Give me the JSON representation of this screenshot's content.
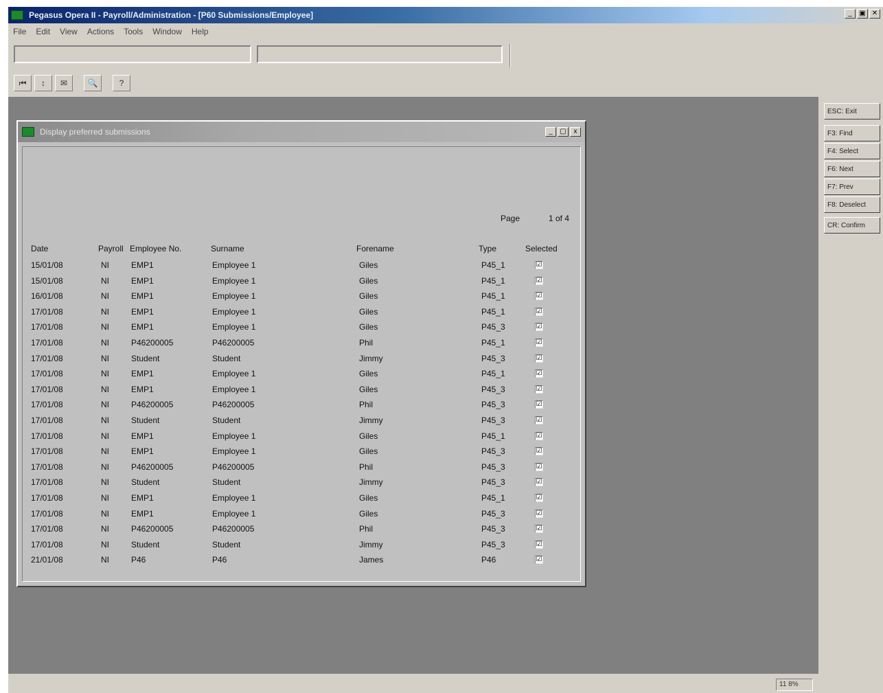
{
  "app": {
    "title": "Pegasus Opera II - Payroll/Administration - [P60 Submissions/Employee]"
  },
  "window_controls": [
    "_",
    "▣",
    "✕"
  ],
  "menu": [
    "File",
    "Edit",
    "View",
    "Actions",
    "Tools",
    "Window",
    "Help"
  ],
  "toolbar": [
    "⏮",
    "↕",
    "✉",
    "🔍",
    "?"
  ],
  "function_keys": [
    "ESC: Exit",
    "F3: Find",
    "F4: Select",
    "F6: Next",
    "F7: Prev",
    "F8: Deselect",
    "CR: Confirm"
  ],
  "status": {
    "zoom": "11 8%"
  },
  "child": {
    "title": "Display preferred submissions",
    "controls": [
      "_",
      "▢",
      "x"
    ],
    "page_label": "Page",
    "page_value": "1 of 4",
    "headers": [
      "Date",
      "Payroll",
      "Employee No.",
      "Surname",
      "Forename",
      "Type",
      "Selected"
    ],
    "rows": [
      [
        "15/01/08",
        "NI",
        "EMP1",
        "Employee 1",
        "Giles",
        "P45_1",
        "☑"
      ],
      [
        "15/01/08",
        "NI",
        "EMP1",
        "Employee 1",
        "Giles",
        "P45_1",
        "☑"
      ],
      [
        "16/01/08",
        "NI",
        "EMP1",
        "Employee 1",
        "Giles",
        "P45_1",
        "☑"
      ],
      [
        "17/01/08",
        "NI",
        "EMP1",
        "Employee 1",
        "Giles",
        "P45_1",
        "☑"
      ],
      [
        "17/01/08",
        "NI",
        "EMP1",
        "Employee 1",
        "Giles",
        "P45_3",
        "☑"
      ],
      [
        "17/01/08",
        "NI",
        "P46200005",
        "P46200005",
        "Phil",
        "P45_1",
        "☑"
      ],
      [
        "17/01/08",
        "NI",
        "Student",
        "Student",
        "Jimmy",
        "P45_3",
        "☑"
      ],
      [
        "17/01/08",
        "NI",
        "EMP1",
        "Employee 1",
        "Giles",
        "P45_1",
        "☑"
      ],
      [
        "17/01/08",
        "NI",
        "EMP1",
        "Employee 1",
        "Giles",
        "P45_3",
        "☑"
      ],
      [
        "17/01/08",
        "NI",
        "P46200005",
        "P46200005",
        "Phil",
        "P45_3",
        "☑"
      ],
      [
        "17/01/08",
        "NI",
        "Student",
        "Student",
        "Jimmy",
        "P45_3",
        "☑"
      ],
      [
        "17/01/08",
        "NI",
        "EMP1",
        "Employee 1",
        "Giles",
        "P45_1",
        "☑"
      ],
      [
        "17/01/08",
        "NI",
        "EMP1",
        "Employee 1",
        "Giles",
        "P45_3",
        "☑"
      ],
      [
        "17/01/08",
        "NI",
        "P46200005",
        "P46200005",
        "Phil",
        "P45_3",
        "☑"
      ],
      [
        "17/01/08",
        "NI",
        "Student",
        "Student",
        "Jimmy",
        "P45_3",
        "☑"
      ],
      [
        "17/01/08",
        "NI",
        "EMP1",
        "Employee 1",
        "Giles",
        "P45_1",
        "☑"
      ],
      [
        "17/01/08",
        "NI",
        "EMP1",
        "Employee 1",
        "Giles",
        "P45_3",
        "☑"
      ],
      [
        "17/01/08",
        "NI",
        "P46200005",
        "P46200005",
        "Phil",
        "P45_3",
        "☑"
      ],
      [
        "17/01/08",
        "NI",
        "Student",
        "Student",
        "Jimmy",
        "P45_3",
        "☑"
      ],
      [
        "21/01/08",
        "NI",
        "P46",
        "P46",
        "James",
        "P46",
        "☑"
      ]
    ]
  },
  "colors": {
    "title_active": "#0a246a",
    "workspace": "#808080",
    "window_face": "#d4d0c8",
    "child_face": "#c0c0c0",
    "app_icon": "#1c8a2c"
  }
}
